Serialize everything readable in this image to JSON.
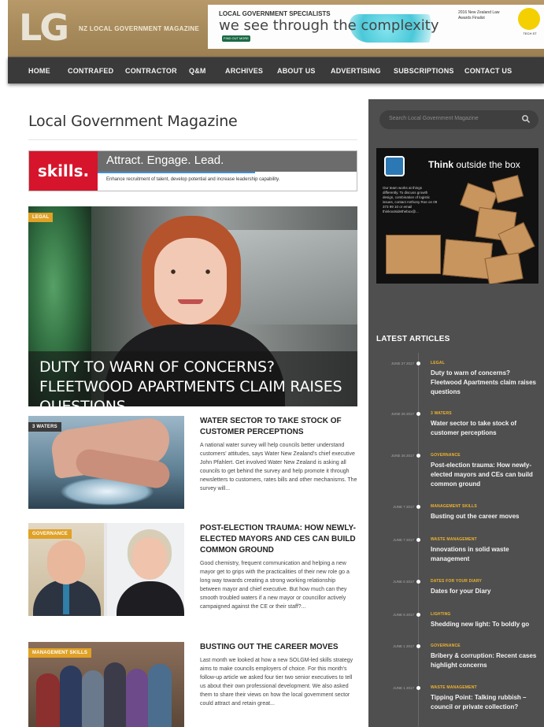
{
  "header": {
    "logo": "LG",
    "logo_tagline": "NZ LOCAL GOVERNMENT MAGAZINE",
    "banner": {
      "kicker": "LOCAL GOVERNMENT SPECIALISTS",
      "headline": "we see through the complexity",
      "button": "FIND OUT MORE",
      "award": "2016 New Zealand Law Awards Finalist",
      "badge": "TECH ST"
    }
  },
  "nav": {
    "items": [
      "HOME",
      "CONTRAFED",
      "CONTRACTOR",
      "Q&M",
      "ARCHIVES",
      "ABOUT US",
      "ADVERTISING",
      "SUBSCRIPTIONS",
      "CONTACT US"
    ]
  },
  "main": {
    "site_title": "Local Government Magazine",
    "ad": {
      "logo": "skills.",
      "headline": "Attract. Engage. Lead.",
      "subline": "Enhance recruitment of talent, develop potential and increase leadership capability."
    },
    "hero": {
      "tag": "LEGAL",
      "title": "DUTY TO WARN OF CONCERNS? FLEETWOOD APARTMENTS CLAIM RAISES QUESTIONS"
    },
    "cards": [
      {
        "tag": "3 WATERS",
        "title": "WATER SECTOR TO TAKE STOCK OF CUSTOMER PERCEPTIONS",
        "excerpt": "A national water survey will help councils better understand customers' attitudes, says Water New Zealand's chief executive John Pfahlert. Get involved Water New Zealand is asking all councils to get behind the survey and help promote it through newsletters to customers, rates bills and other mechanisms. The survey will..."
      },
      {
        "tag": "GOVERNANCE",
        "title": "POST-ELECTION TRAUMA: HOW NEWLY-ELECTED MAYORS AND CES CAN BUILD COMMON GROUND",
        "excerpt": "Good chemistry, frequent communication and helping a new mayor get to grips with the practicalities of their new role go a long way towards creating a strong working relationship between mayor and chief executive. But how much can they smooth troubled waters if a new mayor or councillor actively campaigned against the CE or their staff?..."
      },
      {
        "tag": "MANAGEMENT SKILLS",
        "title": "BUSTING OUT THE CAREER MOVES",
        "excerpt": "Last month we looked at how a new SOLGM-led skills strategy aims to make councils employers of choice. For this month's follow-up article we asked four tier two senior executives to tell us about their own professional development. We also asked them to share their views on how the local government sector could attract and retain great..."
      }
    ]
  },
  "sidebar": {
    "search_placeholder": "Search Local Government Magazine",
    "ad": {
      "headline_bold": "Think",
      "headline_rest": "outside the box",
      "copy": "Our team works at things differently. To discuss growth design, combination of logistic issues, contact Anthony Roe on 09 373 99 10 or email thinkoutsidethebox@..."
    },
    "latest_heading": "LATEST ARTICLES",
    "articles": [
      {
        "date": "JUNE 27 2017",
        "category": "LEGAL",
        "title": "Duty to warn of concerns? Fleetwood Apartments claim raises questions"
      },
      {
        "date": "JUNE 26 2017",
        "category": "3 WATERS",
        "title": "Water sector to take stock of customer perceptions"
      },
      {
        "date": "JUNE 26 2017",
        "category": "GOVERNANCE",
        "title": "Post-election trauma: How newly-elected mayors and CEs can build common ground"
      },
      {
        "date": "JUNE 7 2017",
        "category": "MANAGEMENT SKILLS",
        "title": "Busting out the career moves"
      },
      {
        "date": "JUNE 7 2017",
        "category": "WASTE MANAGEMENT",
        "title": "Innovations in solid waste management"
      },
      {
        "date": "JUNE 6 2017",
        "category": "DATES FOR YOUR DIARY",
        "title": "Dates for your Diary"
      },
      {
        "date": "JUNE 6 2017",
        "category": "LIGHTING",
        "title": "Shedding new light: To boldly go"
      },
      {
        "date": "JUNE 1 2017",
        "category": "GOVERNANCE",
        "title": "Bribery & corruption: Recent cases highlight concerns"
      },
      {
        "date": "JUNE 1 2017",
        "category": "WASTE MANAGEMENT",
        "title": "Tipping Point: Talking rubbish – council or private collection?"
      }
    ]
  },
  "colors": {
    "nav_bg": "#3a3a3a",
    "sidebar_bg": "#4f4f4f",
    "accent_orange": "#e0a126",
    "category_gold": "#f0b32f",
    "skills_red": "#d6152c"
  }
}
